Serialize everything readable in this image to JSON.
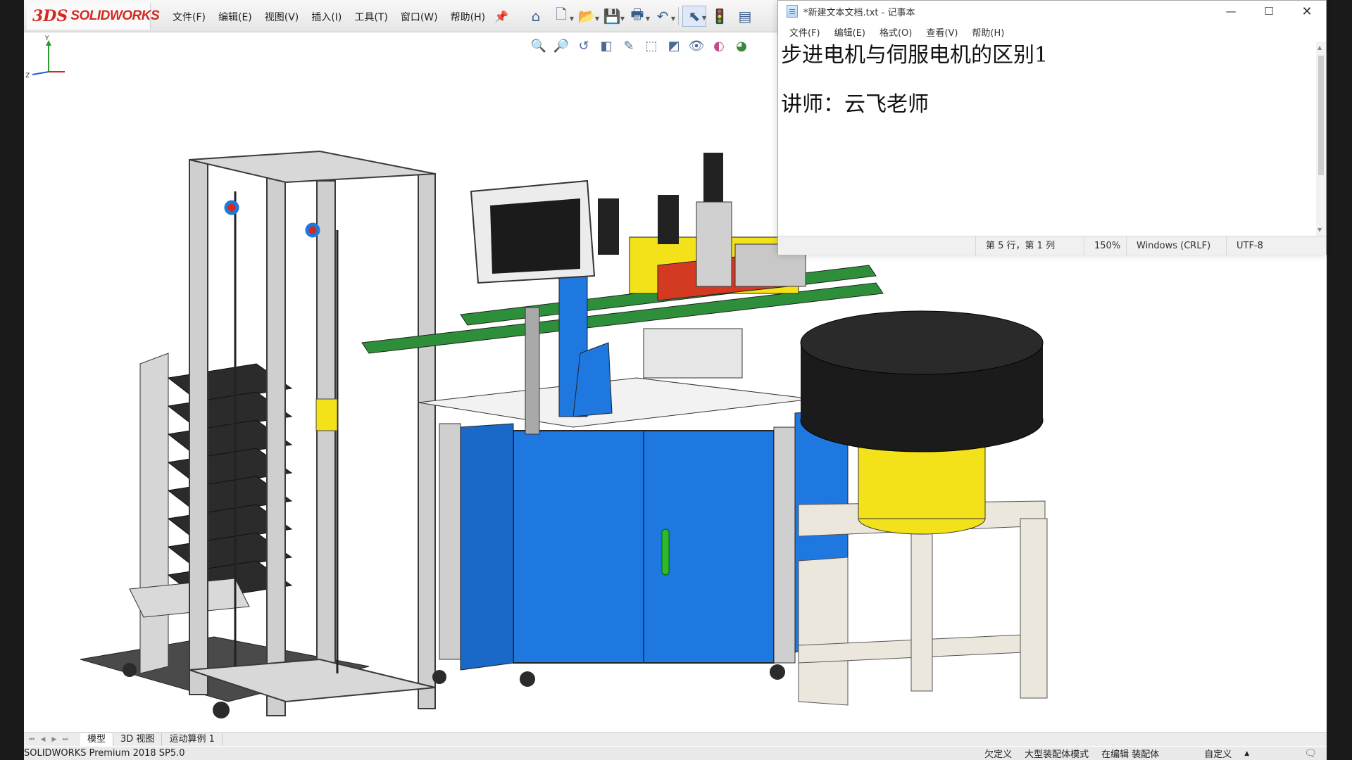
{
  "solidworks": {
    "logo_mark": "3DS",
    "logo_text": "SOLIDWORKS",
    "menus": [
      "文件(F)",
      "编辑(E)",
      "视图(V)",
      "插入(I)",
      "工具(T)",
      "窗口(W)",
      "帮助(H)"
    ],
    "toolbar_icons": [
      "home-icon",
      "new-document-icon",
      "open-icon",
      "save-icon",
      "print-icon",
      "undo-icon",
      "select-icon",
      "rebuild-icon",
      "options-icon"
    ],
    "view_icons": [
      "zoom-to-fit-icon",
      "zoom-to-area-icon",
      "previous-view-icon",
      "section-view-icon",
      "dynamic-annotation-icon",
      "view-orientation-icon",
      "display-style-icon",
      "hide-show-icon",
      "edit-appearance-icon",
      "apply-scene-icon"
    ],
    "tabs": [
      "模型",
      "3D 视图",
      "运动算例 1"
    ],
    "status": {
      "product": "SOLIDWORKS Premium 2018 SP5.0",
      "items": [
        "欠定义",
        "大型装配体模式",
        "在编辑 装配体",
        "自定义"
      ]
    },
    "colors": {
      "accent_red": "#d22a1f",
      "machine_blue": "#1e78e0",
      "bowl_black": "#1b1b1b",
      "bowl_yellow": "#f3e21a",
      "stand_beige": "#ece7dc",
      "frame_gray": "#c7c7c7"
    }
  },
  "notepad": {
    "title": "*新建文本文档.txt - 记事本",
    "menus": [
      "文件(F)",
      "编辑(E)",
      "格式(O)",
      "查看(V)",
      "帮助(H)"
    ],
    "lines": [
      "步进电机与伺服电机的区别1",
      "",
      "讲师：云飞老师"
    ],
    "statusbar": {
      "position": "第 5 行，第 1 列",
      "zoom": "150%",
      "line_ending": "Windows (CRLF)",
      "encoding": "UTF-8"
    },
    "window_buttons": {
      "minimize": "—",
      "maximize": "☐",
      "close": "✕"
    }
  }
}
